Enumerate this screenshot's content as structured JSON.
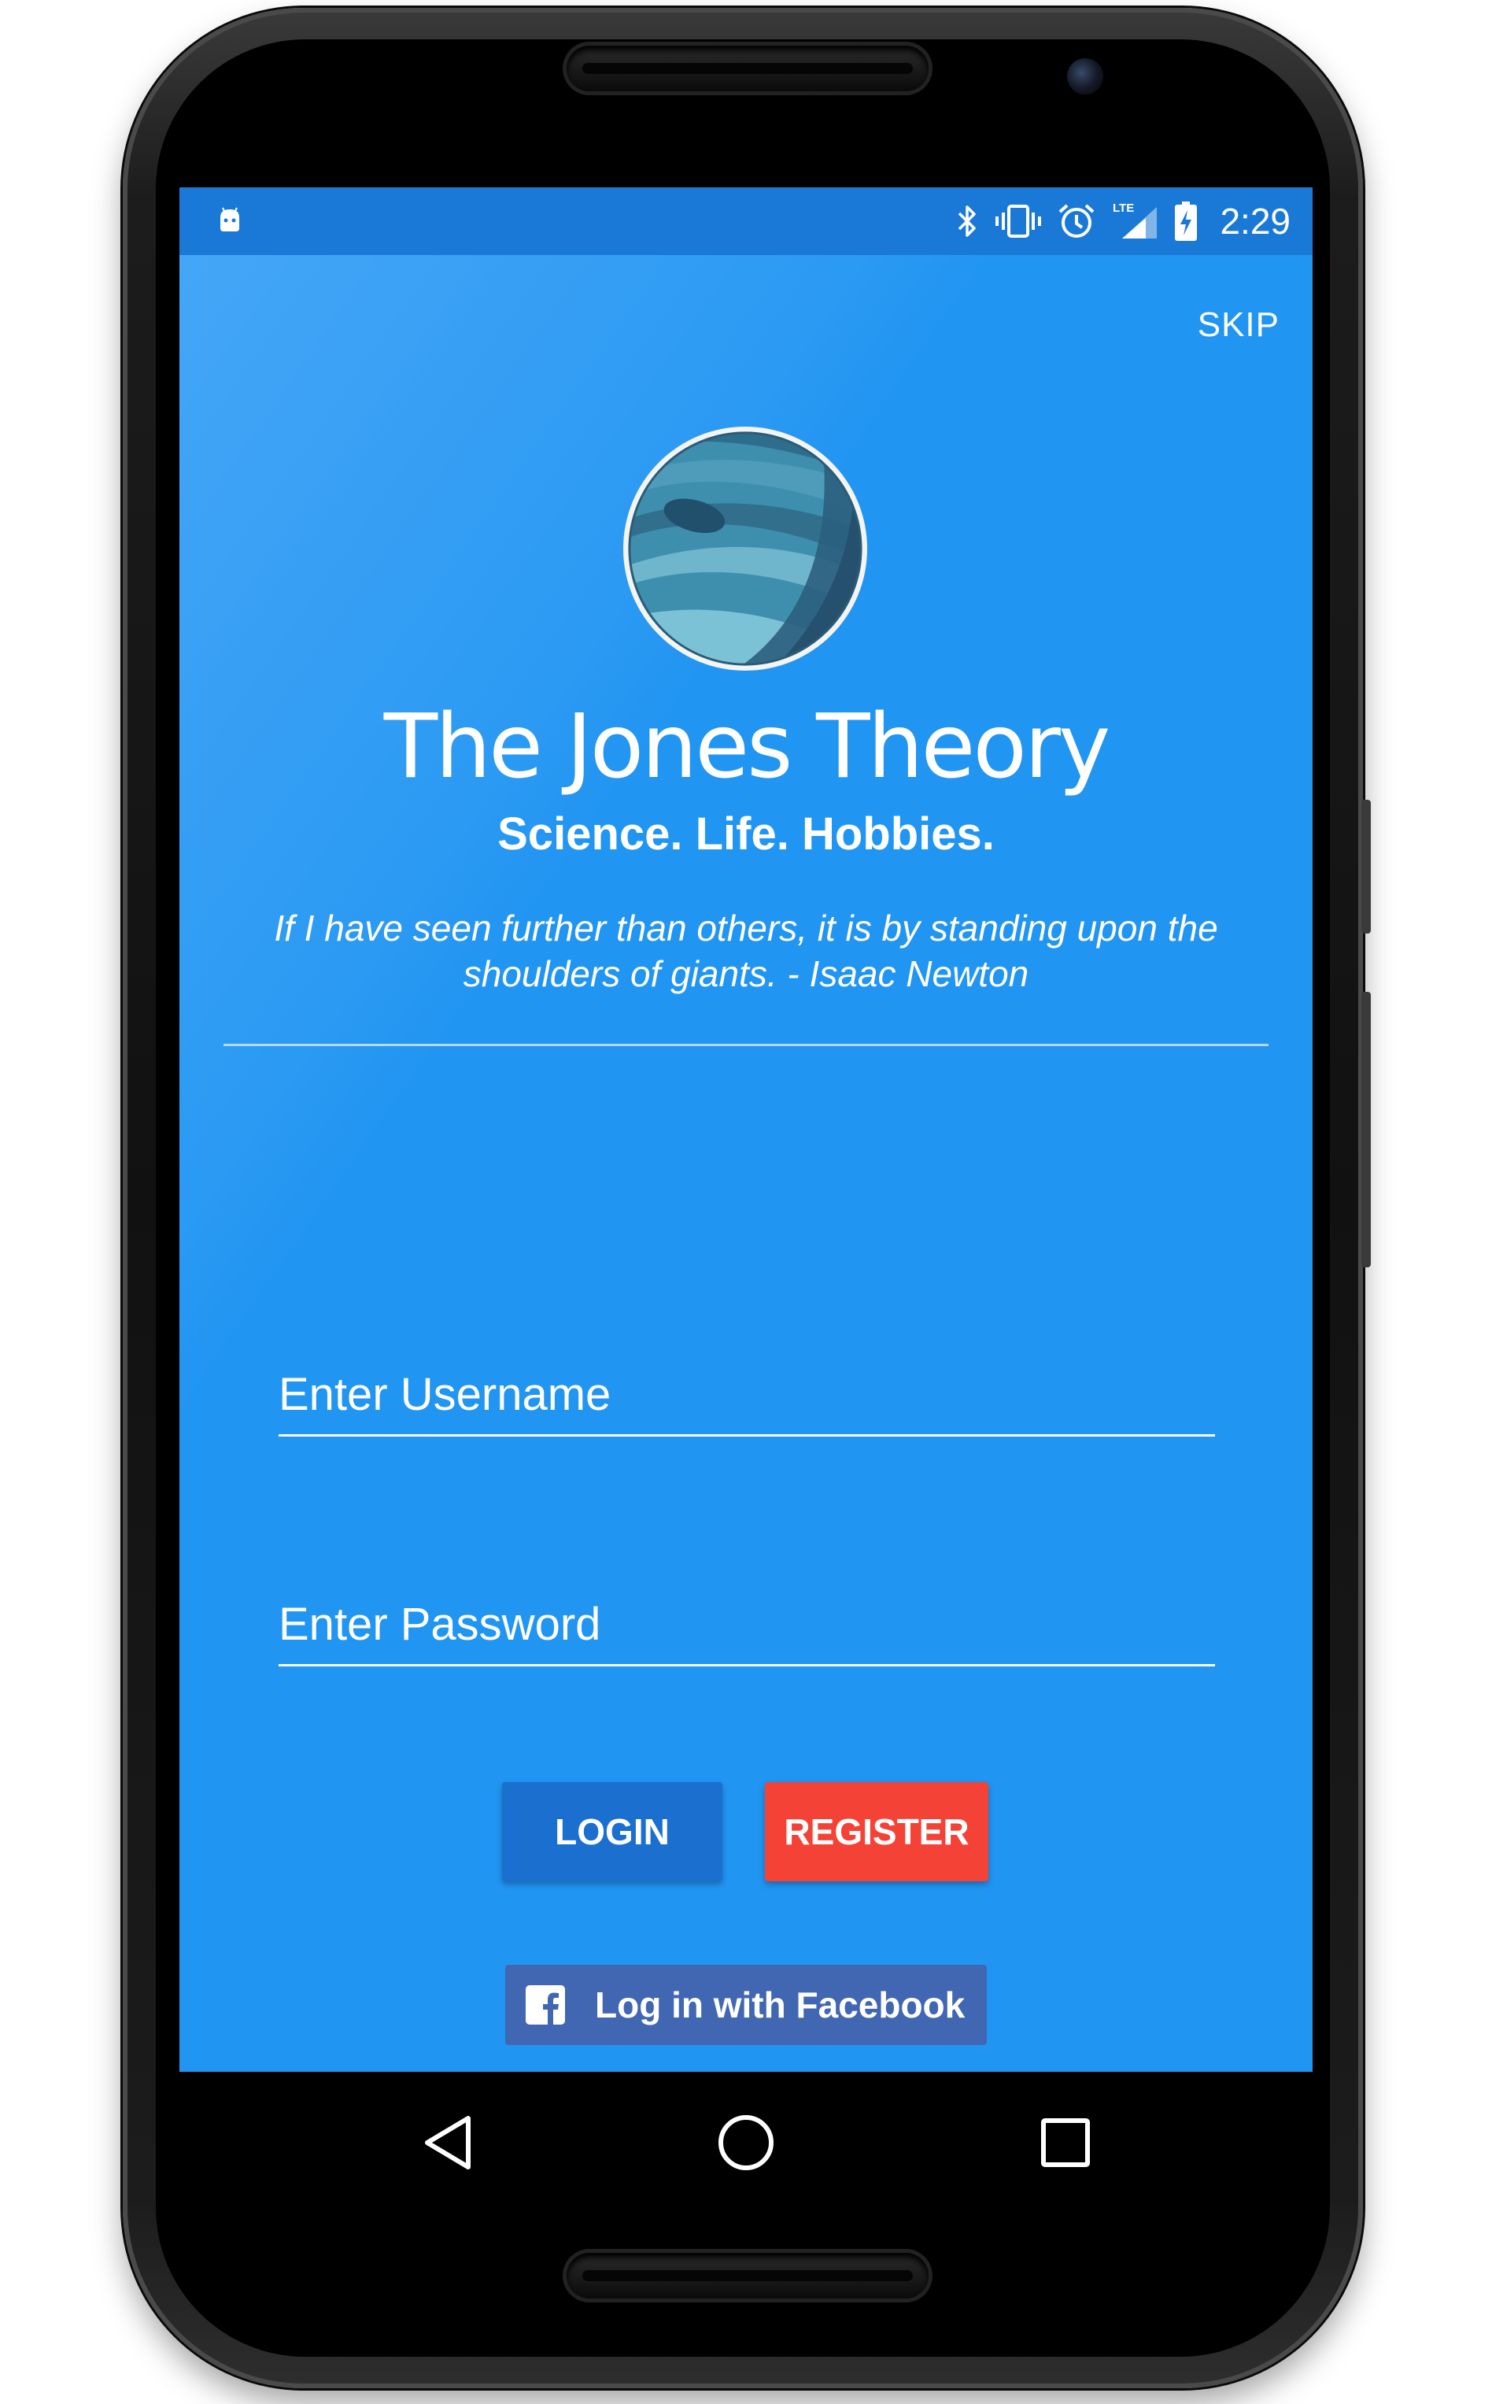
{
  "status_bar": {
    "time": "2:29",
    "network": "LTE",
    "icons": [
      "android-debug-icon",
      "bluetooth-icon",
      "vibrate-icon",
      "alarm-icon",
      "lte-signal-icon",
      "battery-charging-icon"
    ]
  },
  "header": {
    "skip_label": "SKIP"
  },
  "branding": {
    "title": "The Jones Theory",
    "tagline": "Science. Life. Hobbies.",
    "quote": "If I have seen further than others, it is by standing upon the shoulders of giants. - Isaac Newton"
  },
  "form": {
    "username_placeholder": "Enter Username",
    "password_placeholder": "Enter Password",
    "login_label": "LOGIN",
    "register_label": "REGISTER",
    "facebook_label": "Log in with Facebook"
  },
  "colors": {
    "background": "#2195F2",
    "status_bar": "#1A79D6",
    "login_button": "#1A6FCF",
    "register_button": "#F44336",
    "facebook_button": "#4267B2"
  },
  "navigation": {
    "icons": [
      "back-icon",
      "home-icon",
      "recents-icon"
    ]
  }
}
